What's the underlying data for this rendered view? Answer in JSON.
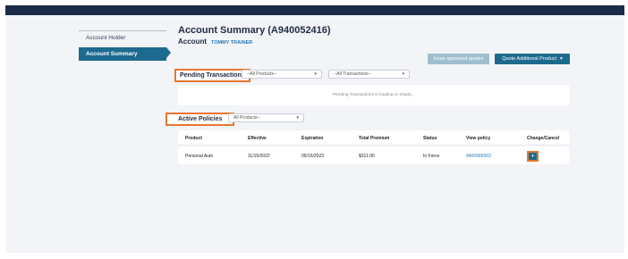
{
  "sidebar": {
    "items": [
      {
        "label": "Account Holder"
      },
      {
        "label": "Account Summary"
      }
    ]
  },
  "header": {
    "title": "Account Summary (A940052416)",
    "account_label": "Account",
    "account_holder": "TOMMY TRAINER"
  },
  "actions": {
    "issue_label": "Issue approved quotes",
    "quote_label": "Quote Additional Product",
    "quote_icon": "chevron-down-icon"
  },
  "pending": {
    "label": "Pending Transactions",
    "product_filter": "--All Products--",
    "transaction_filter": "--All Transactions--",
    "empty_text": "Pending Transactions is loading or empty..."
  },
  "active": {
    "label": "Active Policies",
    "product_filter": "All Products--",
    "columns": [
      "Product",
      "Effective",
      "Expiration",
      "Total Premium",
      "Status",
      "View policy",
      "Change/Cancel"
    ],
    "rows": [
      {
        "product": "Personal Auto",
        "effective": "11/15/2022",
        "expiration": "05/15/2023",
        "premium": "$311.00",
        "status": "In Force",
        "policy": "9400065563"
      }
    ]
  },
  "colors": {
    "nav": "#1c2b4a",
    "accent": "#1d6a8e",
    "highlight": "#e8772e",
    "link": "#2a7ab8"
  }
}
